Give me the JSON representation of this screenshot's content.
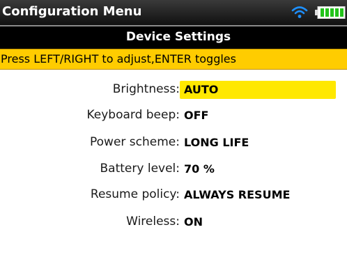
{
  "titlebar": {
    "title": "Configuration Menu",
    "icons": {
      "wifi": "wifi-icon",
      "battery": "battery-icon"
    },
    "colors": {
      "wifi": "#1e90ff",
      "battery_fill": "#22c31a"
    }
  },
  "section": {
    "title": "Device Settings"
  },
  "hint": {
    "text": "Press LEFT/RIGHT to adjust,ENTER toggles"
  },
  "settings": [
    {
      "label": "Brightness:",
      "value": "AUTO",
      "selected": true
    },
    {
      "label": "Keyboard beep:",
      "value": "OFF",
      "selected": false
    },
    {
      "label": "Power scheme:",
      "value": "LONG LIFE",
      "selected": false
    },
    {
      "label": "Battery level:",
      "value": "70 %",
      "selected": false
    },
    {
      "label": "Resume policy:",
      "value": "ALWAYS RESUME",
      "selected": false
    },
    {
      "label": "Wireless:",
      "value": "ON",
      "selected": false
    }
  ],
  "theme": {
    "highlight": "#ffe800",
    "hint_bar": "#ffcc00",
    "header": "#000000"
  }
}
